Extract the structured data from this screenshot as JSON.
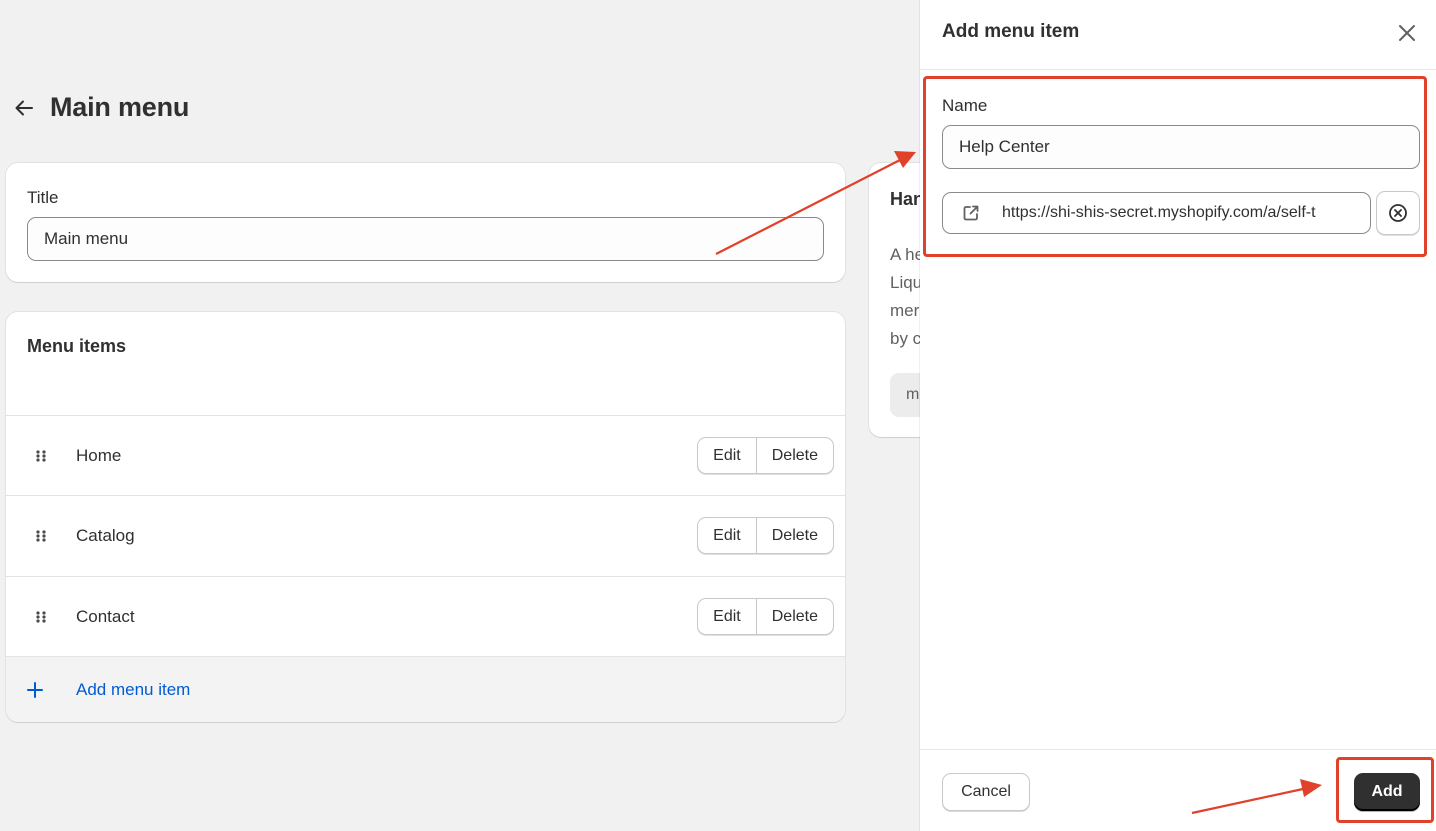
{
  "page": {
    "title": "Main menu",
    "title_card": {
      "label": "Title",
      "value": "Main menu"
    },
    "menu_items_card": {
      "heading": "Menu items",
      "items": [
        {
          "label": "Home",
          "edit_label": "Edit",
          "delete_label": "Delete"
        },
        {
          "label": "Catalog",
          "edit_label": "Edit",
          "delete_label": "Delete"
        },
        {
          "label": "Contact",
          "edit_label": "Edit",
          "delete_label": "Delete"
        }
      ],
      "add_label": "Add menu item"
    },
    "side_card": {
      "title_fragment": "Han",
      "text_lines": [
        "A he",
        "Liqu",
        "mer",
        "by c"
      ],
      "chip_fragment": "m"
    }
  },
  "drawer": {
    "title": "Add menu item",
    "name_label": "Name",
    "name_value": "Help Center",
    "link_value": "https://shi-shis-secret.myshopify.com/a/self-t",
    "cancel_label": "Cancel",
    "add_label": "Add"
  },
  "colors": {
    "background": "#f1f1f1",
    "link_blue": "#005bd3",
    "primary_button": "#303030",
    "annotation_red": "#e0412b"
  },
  "icons": [
    "back-arrow-icon",
    "drag-handle-icon",
    "plus-icon",
    "close-icon",
    "external-link-icon",
    "clear-circle-icon"
  ]
}
